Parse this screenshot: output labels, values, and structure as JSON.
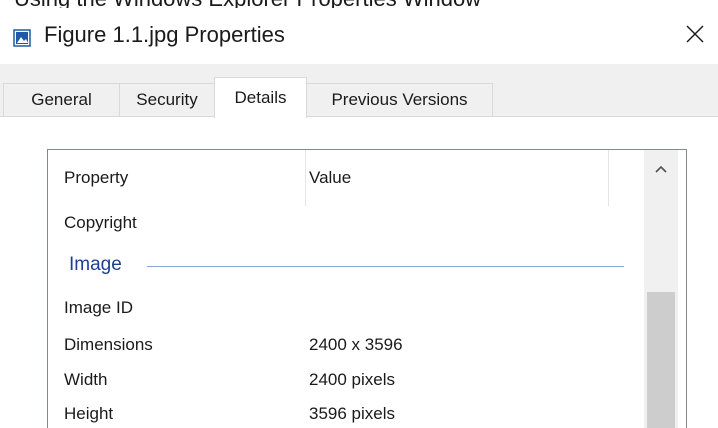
{
  "window": {
    "prev_caption": "Using the Windows Explorer Properties Window",
    "title": "Figure 1.1.jpg Properties"
  },
  "icons": {
    "title": "image-file-icon",
    "close": "close-icon",
    "scroll_up": "chevron-up-icon"
  },
  "tabs": [
    {
      "label": "General"
    },
    {
      "label": "Security"
    },
    {
      "label": "Details"
    },
    {
      "label": "Previous Versions"
    }
  ],
  "active_tab": "Details",
  "details": {
    "columns": [
      "Property",
      "Value"
    ],
    "rows": [
      {
        "property": "Copyright",
        "value": ""
      }
    ],
    "group": "Image",
    "group_rows": [
      {
        "property": "Image ID",
        "value": ""
      },
      {
        "property": "Dimensions",
        "value": "2400 x 3596"
      },
      {
        "property": "Width",
        "value": "2400 pixels"
      },
      {
        "property": "Height",
        "value": "3596 pixels"
      }
    ]
  },
  "colors": {
    "group_label": "#1e3d96",
    "group_line": "#8aa6d6",
    "scroll_thumb": "#cdcdcd",
    "title_icon": "#1e5aa8"
  }
}
